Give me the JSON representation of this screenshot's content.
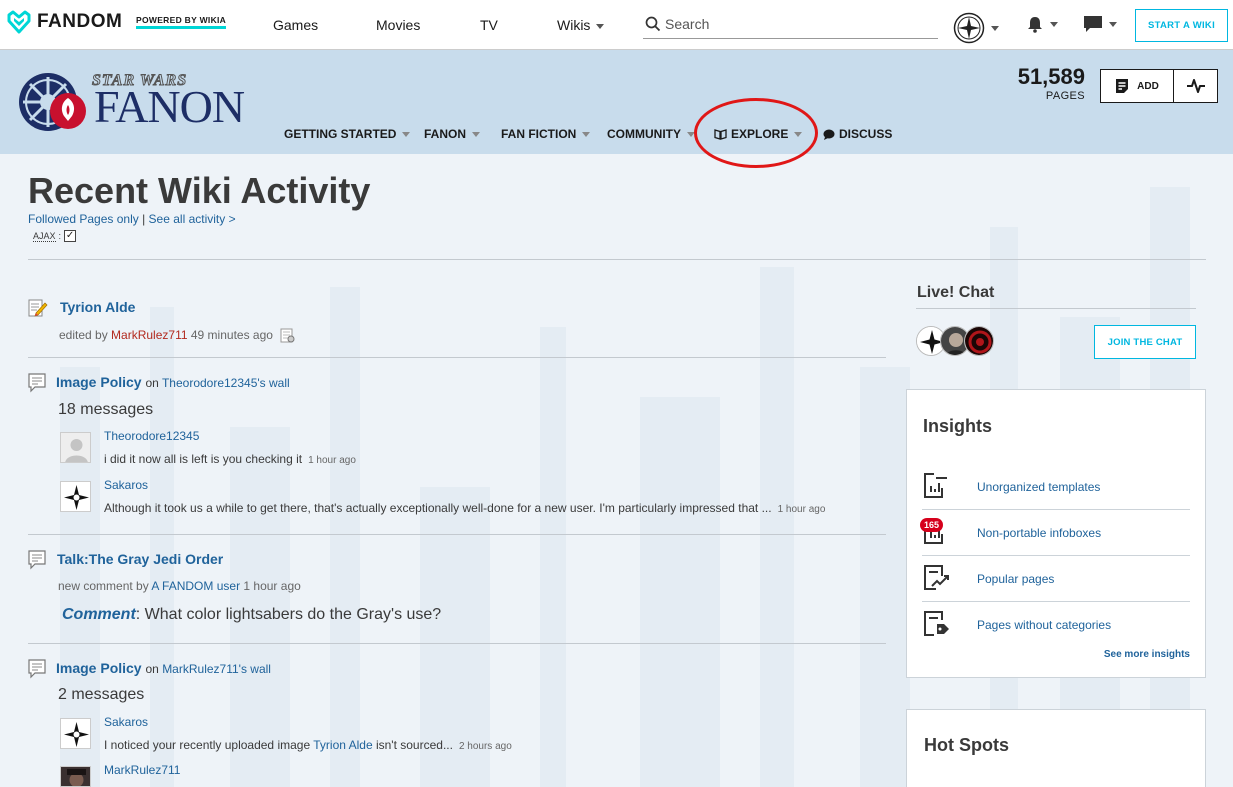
{
  "global_nav": {
    "brand": "FANDOM",
    "powered": "POWERED BY WIKIA",
    "items": [
      {
        "label": "Games"
      },
      {
        "label": "Movies"
      },
      {
        "label": "TV"
      },
      {
        "label": "Wikis"
      }
    ],
    "search_placeholder": "Search",
    "start_wiki": "START A WIKI",
    "accent": "#00d6d6"
  },
  "community": {
    "logo_top": "STAR WARS",
    "logo_main": "FANON",
    "page_count": "51,589",
    "pages_label": "PAGES",
    "add_label": "ADD",
    "nav": [
      {
        "label": "GETTING STARTED"
      },
      {
        "label": "FANON"
      },
      {
        "label": "FAN FICTION"
      },
      {
        "label": "COMMUNITY"
      },
      {
        "label": "EXPLORE"
      },
      {
        "label": "DISCUSS"
      }
    ]
  },
  "page": {
    "title": "Recent Wiki Activity",
    "followed": "Followed Pages only",
    "sep": "|",
    "see_all": "See all activity >",
    "ajax": "AJAX",
    "ajax_colon": ":",
    "ajax_check": "✓"
  },
  "activity": [
    {
      "title": "Tyrion Alde",
      "meta_prefix": "edited by",
      "user": "MarkRulez711",
      "time": "49 minutes ago"
    },
    {
      "title": "Image Policy",
      "on_word": "on",
      "wall": "Theorodore12345's wall",
      "count": "18 messages",
      "messages": [
        {
          "user": "Theorodore12345",
          "text": "i did it now all is left is you checking it",
          "time": "1 hour ago"
        },
        {
          "user": "Sakaros",
          "text": "Although it took us a while to get there, that's actually exceptionally well-done for a new user. I'm particularly impressed that ...",
          "time": "1 hour ago"
        }
      ]
    },
    {
      "title": "Talk:The Gray Jedi Order",
      "meta_prefix": "new comment by",
      "user": "A FANDOM user",
      "time": "1 hour ago",
      "comment_label": "Comment",
      "comment_text": ": What color lightsabers do the Gray's use?"
    },
    {
      "title": "Image Policy",
      "on_word": "on",
      "wall": "MarkRulez711's wall",
      "count": "2 messages",
      "messages": [
        {
          "user": "Sakaros",
          "text_pre": "I noticed your recently uploaded image ",
          "link": "Tyrion Alde",
          "text_post": " isn't sourced...",
          "time": "2 hours ago"
        },
        {
          "user": "MarkRulez711"
        }
      ]
    }
  ],
  "rail": {
    "chat_title": "Live! Chat",
    "join": "JOIN THE CHAT",
    "insights_title": "Insights",
    "insights": [
      {
        "label": "Unorganized templates"
      },
      {
        "label": "Non-portable infoboxes",
        "badge": "165"
      },
      {
        "label": "Popular pages"
      },
      {
        "label": "Pages without categories"
      }
    ],
    "see_more": "See more insights",
    "hot_spots": "Hot Spots"
  },
  "icons": [
    "fandom-heart-icon",
    "search-icon",
    "avatar-icon",
    "bell-icon",
    "chat-bubble-icon",
    "add-page-icon",
    "activity-icon",
    "explore-book-icon",
    "discuss-bubble-icon",
    "edit-pencil-icon",
    "talk-bubble-icon",
    "diff-icon",
    "insight-page-icon"
  ]
}
